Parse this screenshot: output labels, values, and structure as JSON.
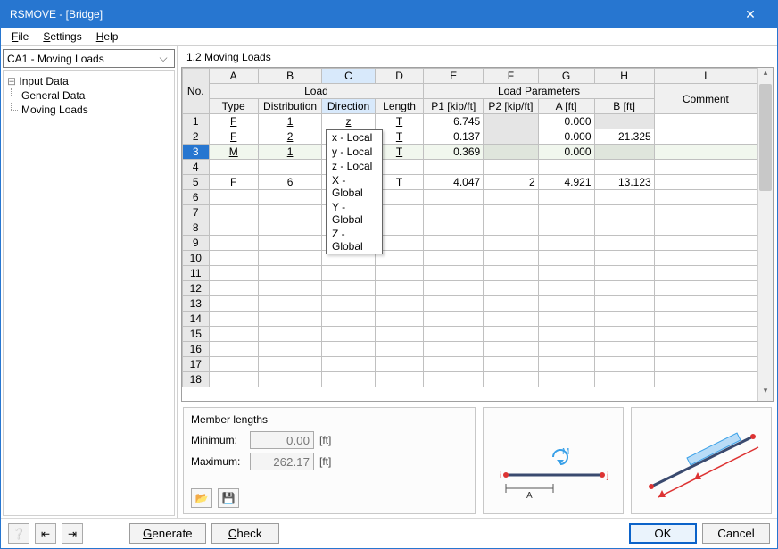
{
  "title": "RSMOVE - [Bridge]",
  "menus": {
    "file": "File",
    "settings": "Settings",
    "help": "Help"
  },
  "sidebar": {
    "combo": "CA1 - Moving Loads",
    "tree": {
      "root": "Input Data",
      "children": [
        "General Data",
        "Moving Loads"
      ]
    }
  },
  "main_title": "1.2 Moving Loads",
  "columns": {
    "letters": [
      "A",
      "B",
      "C",
      "D",
      "E",
      "F",
      "G",
      "H",
      "I"
    ],
    "group_load": "Load",
    "group_params": "Load Parameters",
    "no": "No.",
    "type": "Type",
    "distribution": "Distribution",
    "direction": "Direction",
    "length": "Length",
    "p1": "P1 [kip/ft]",
    "p2": "P2 [kip/ft]",
    "a": "A [ft]",
    "b": "B [ft]",
    "comment": "Comment"
  },
  "rows": [
    {
      "n": "1",
      "type": "F",
      "dist": "1",
      "dir": "z",
      "len": "T",
      "p1": "6.745",
      "p2": "",
      "a": "0.000",
      "b": "",
      "p2_disabled": true,
      "b_disabled": true
    },
    {
      "n": "2",
      "type": "F",
      "dist": "2",
      "dir": "z",
      "len": "T",
      "p1": "0.137",
      "p2": "",
      "a": "0.000",
      "b": "21.325",
      "p2_disabled": true
    },
    {
      "n": "3",
      "type": "M",
      "dist": "1",
      "dir": "x",
      "len": "T",
      "p1": "0.369",
      "p2": "",
      "a": "0.000",
      "b": "",
      "p2_disabled": true,
      "b_disabled": true,
      "selected": true,
      "active_dir": true
    },
    {
      "n": "4"
    },
    {
      "n": "5",
      "type": "F",
      "dist": "6",
      "dir": "",
      "len": "T",
      "p1": "4.047",
      "p2": "2",
      "a": "4.921",
      "b": "13.123"
    },
    {
      "n": "6"
    },
    {
      "n": "7"
    },
    {
      "n": "8"
    },
    {
      "n": "9"
    },
    {
      "n": "10"
    },
    {
      "n": "11"
    },
    {
      "n": "12"
    },
    {
      "n": "13"
    },
    {
      "n": "14"
    },
    {
      "n": "15"
    },
    {
      "n": "16"
    },
    {
      "n": "17"
    },
    {
      "n": "18"
    }
  ],
  "dropdown": {
    "options": [
      "x - Local",
      "y - Local",
      "z - Local",
      "X - Global",
      "Y - Global",
      "Z - Global"
    ]
  },
  "lengths": {
    "title": "Member lengths",
    "min_label": "Minimum:",
    "min": "0.00",
    "max_label": "Maximum:",
    "max": "262.17",
    "unit": "[ft]"
  },
  "footer": {
    "generate": "Generate",
    "check": "Check",
    "ok": "OK",
    "cancel": "Cancel"
  }
}
